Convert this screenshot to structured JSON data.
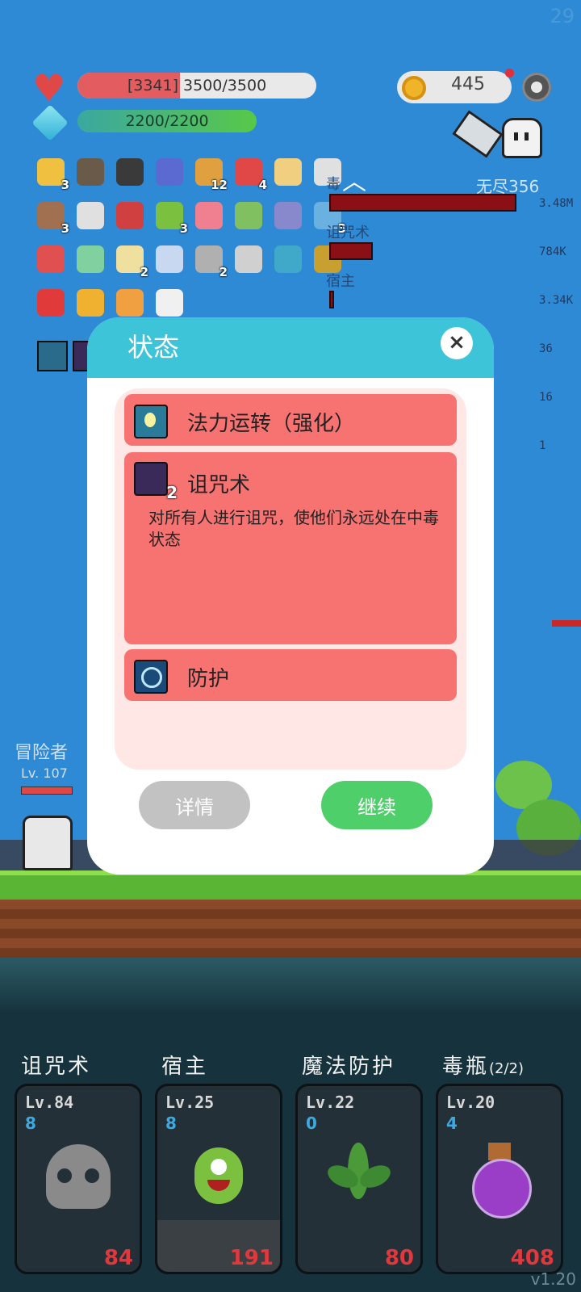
{
  "hud": {
    "fps": "29",
    "hp_text": "[3341] 3500/3500",
    "hp_fill": 0.43,
    "mp_text": "2200/2200",
    "mp_fill": 1.0,
    "coins": "445",
    "colors": {
      "hp": "#e35d60",
      "mp": "#4fbf4a",
      "accent": "#3ec4d8"
    }
  },
  "items": [
    {
      "icon": "beer-icon",
      "count": "3"
    },
    {
      "icon": "mortar-icon",
      "count": ""
    },
    {
      "icon": "cauldron-icon",
      "count": ""
    },
    {
      "icon": "wizard-hat-icon",
      "count": ""
    },
    {
      "icon": "book-icon",
      "count": "12"
    },
    {
      "icon": "watermelon-icon",
      "count": "4"
    },
    {
      "icon": "id-card-icon",
      "count": ""
    },
    {
      "icon": "pill-icon",
      "count": ""
    },
    {
      "icon": "shield-round-icon",
      "count": "3"
    },
    {
      "icon": "hook-icon",
      "count": ""
    },
    {
      "icon": "crest-icon",
      "count": ""
    },
    {
      "icon": "flask-icon",
      "count": "3"
    },
    {
      "icon": "ice-cream-icon",
      "count": ""
    },
    {
      "icon": "note-icon",
      "count": ""
    },
    {
      "icon": "robot-icon",
      "count": ""
    },
    {
      "icon": "speech-icon",
      "count": "3"
    },
    {
      "icon": "mushroom-icon",
      "count": ""
    },
    {
      "icon": "ghost-icon",
      "count": ""
    },
    {
      "icon": "flower-icon",
      "count": "2"
    },
    {
      "icon": "capsule-icon",
      "count": ""
    },
    {
      "icon": "dagger-icon",
      "count": "2"
    },
    {
      "icon": "dots-icon",
      "count": ""
    },
    {
      "icon": "target-icon",
      "count": ""
    },
    {
      "icon": "egg-icon",
      "count": ""
    },
    {
      "icon": "apple-icon",
      "count": ""
    },
    {
      "icon": "pineapple-icon",
      "count": ""
    },
    {
      "icon": "comet-icon",
      "count": ""
    },
    {
      "icon": "cards-icon",
      "count": ""
    }
  ],
  "damage": {
    "header": "无尽356",
    "rows": [
      {
        "label": "毒",
        "value": "3.48M"
      },
      {
        "label": "诅咒术",
        "value": "784K"
      },
      {
        "label": "宿主",
        "value": "3.34K"
      }
    ],
    "extra_values": [
      "36",
      "16",
      "1"
    ]
  },
  "player": {
    "name": "冒险者",
    "level": "Lv. 107"
  },
  "modal": {
    "title": "状态",
    "close_label": "×",
    "rows": [
      {
        "title": "法力运转（强化）",
        "count": "",
        "desc": ""
      },
      {
        "title": "诅咒术",
        "count": "2",
        "desc": "对所有人进行诅咒，使他们永远处在中毒状态"
      },
      {
        "title": "防护",
        "count": "",
        "desc": ""
      }
    ],
    "details_label": "详情",
    "continue_label": "继续"
  },
  "skills": [
    {
      "name": "诅咒术",
      "suffix": "",
      "level": "Lv.84",
      "cost": "8",
      "value": "84",
      "icon": "skull-icon"
    },
    {
      "name": "宿主",
      "suffix": "",
      "level": "Lv.25",
      "cost": "8",
      "value": "191",
      "icon": "germ-icon"
    },
    {
      "name": "魔法防护",
      "suffix": "",
      "level": "Lv.22",
      "cost": "0",
      "value": "80",
      "icon": "leaf-icon"
    },
    {
      "name": "毒瓶",
      "suffix": "(2/2)",
      "level": "Lv.20",
      "cost": "4",
      "value": "408",
      "icon": "potion-icon"
    }
  ],
  "version": "v1.20"
}
